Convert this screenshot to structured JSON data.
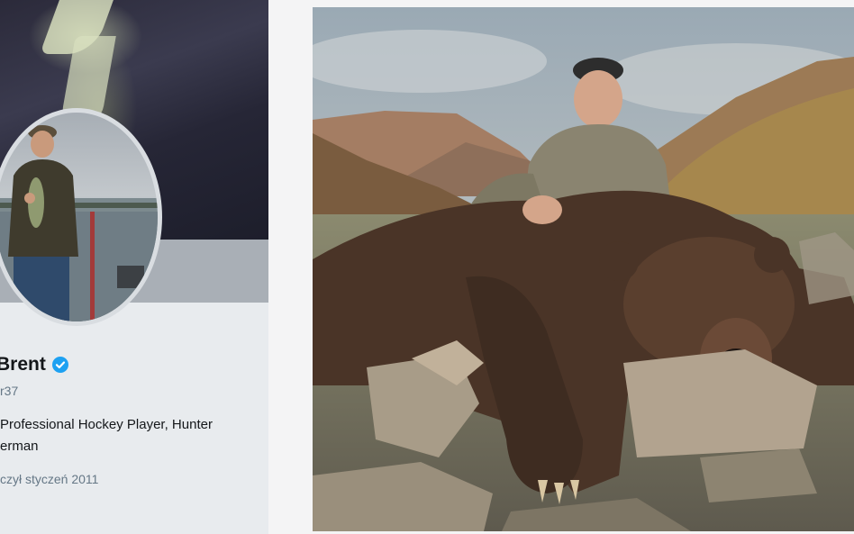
{
  "profile": {
    "name": "Brent",
    "handle": "r37",
    "bio_line1": "Professional Hockey Player, Hunter",
    "bio_line2": "erman",
    "joined": "czył styczeń 2011",
    "verified_color": "#1da1f2"
  },
  "photo": {
    "subject_icon": "hunter-with-bear-photo"
  }
}
